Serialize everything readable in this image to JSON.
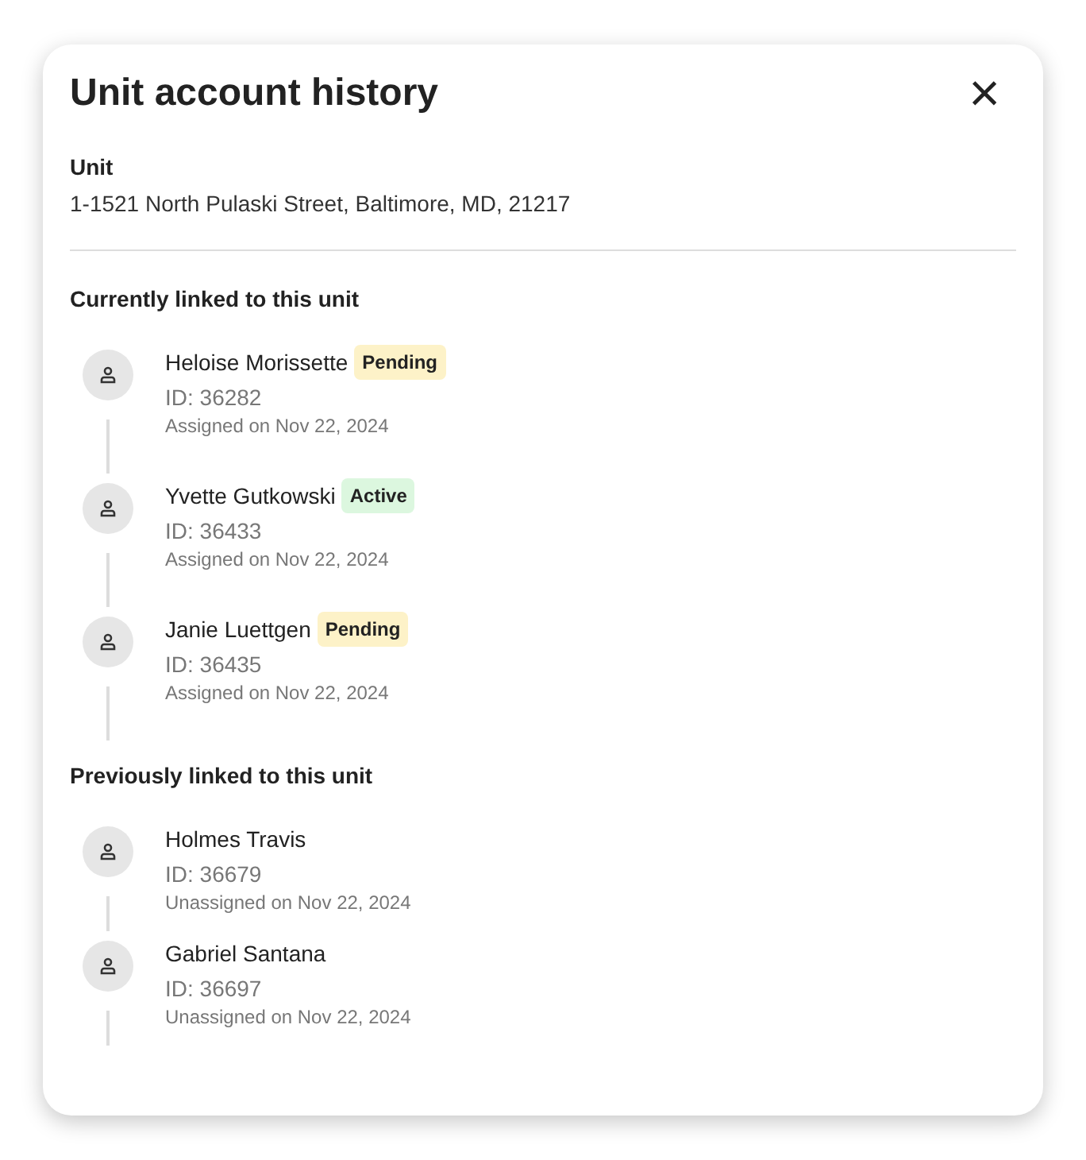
{
  "dialog": {
    "title": "Unit account history",
    "close": "×"
  },
  "unit": {
    "label": "Unit",
    "address": "1-1521 North Pulaski Street, Baltimore, MD, 21217"
  },
  "sections": [
    {
      "heading": "Currently linked to this unit",
      "people": [
        {
          "name": "Heloise Morissette",
          "status": {
            "kind": "pending",
            "label": "Pending"
          },
          "id": "ID: 36282",
          "date": "Assigned on Nov 22, 2024"
        },
        {
          "name": "Yvette Gutkowski",
          "status": {
            "kind": "active",
            "label": "Active"
          },
          "id": "ID: 36433",
          "date": "Assigned on Nov 22, 2024"
        },
        {
          "name": "Janie Luettgen",
          "status": {
            "kind": "pending",
            "label": "Pending"
          },
          "id": "ID: 36435",
          "date": "Assigned on Nov 22, 2024"
        }
      ]
    },
    {
      "heading": "Previously linked to this unit",
      "people": [
        {
          "name": "Holmes Travis",
          "id": "ID: 36679",
          "date": "Unassigned on Nov 22, 2024"
        },
        {
          "name": "Gabriel Santana",
          "id": "ID: 36697",
          "date": "Unassigned on Nov 22, 2024"
        }
      ]
    }
  ]
}
